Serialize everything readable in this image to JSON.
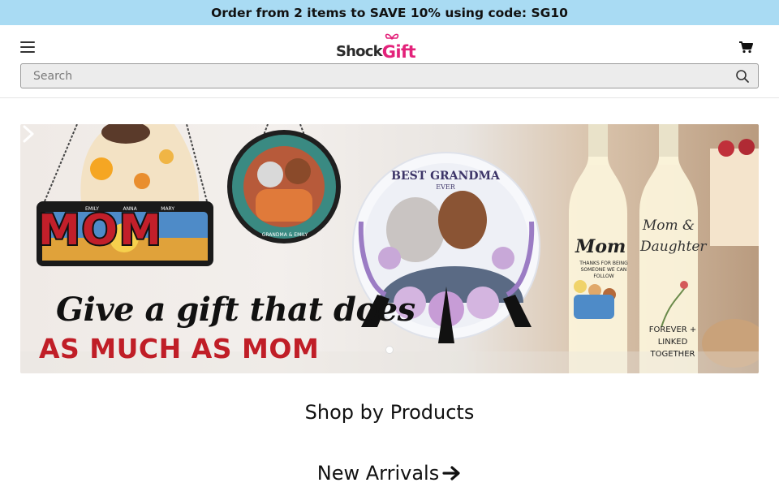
{
  "promo": {
    "text": "Order from 2 items to SAVE 10% using code: SG10"
  },
  "header": {
    "logo": {
      "part1": "Shock",
      "part2": "Gift"
    },
    "search": {
      "placeholder": "Search",
      "value": ""
    }
  },
  "banner": {
    "headline_script": "Give a gift that does",
    "headline_bold": "AS MUCH AS MOM",
    "keepsake_word": "MOM",
    "keepsake_names": [
      "EMILY",
      "ANNA",
      "MARY"
    ],
    "medallion_label": "GRANDMA & EMILY",
    "plate_title": "BEST GRANDMA",
    "plate_subtitle": "EVER",
    "bottle_a_title": "Mom",
    "bottle_a_text": "THANKS FOR BEING SOMEONE WE CAN FOLLOW",
    "bottle_b_title": "Mom & Daughter",
    "bottle_b_text": "FOREVER + LINKED TOGETHER",
    "slide_count": 1,
    "active_slide": 1
  },
  "sections": {
    "shop_by_products": "Shop by Products",
    "new_arrivals": "New Arrivals"
  },
  "colors": {
    "promo_bg": "#a9dbf3",
    "brand_pink": "#e3227a",
    "headline_red": "#c01e27"
  },
  "icons": [
    "hamburger-menu-icon",
    "cart-icon",
    "search-icon",
    "chevron-right-icon",
    "arrow-right-icon"
  ]
}
